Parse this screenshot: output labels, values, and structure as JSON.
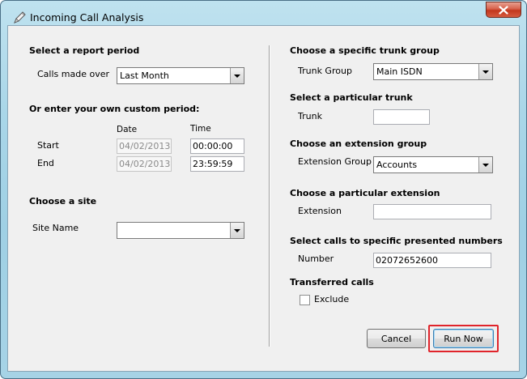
{
  "window": {
    "title": "Incoming Call Analysis"
  },
  "left": {
    "report_period_header": "Select a report period",
    "calls_made_over_label": "Calls made over",
    "calls_made_over_value": "Last Month",
    "custom_period_header": "Or enter your own custom period:",
    "date_col_label": "Date",
    "time_col_label": "Time",
    "start_label": "Start",
    "start_date": "04/02/2013",
    "start_time": "00:00:00",
    "end_label": "End",
    "end_date": "04/02/2013",
    "end_time": "23:59:59",
    "site_header": "Choose a site",
    "site_name_label": "Site Name",
    "site_name_value": ""
  },
  "right": {
    "trunk_group_header": "Choose a specific trunk group",
    "trunk_group_label": "Trunk Group",
    "trunk_group_value": "Main ISDN",
    "trunk_header": "Select a particular trunk",
    "trunk_label": "Trunk",
    "trunk_value": "",
    "ext_group_header": "Choose an extension group",
    "ext_group_label": "Extension Group",
    "ext_group_value": "Accounts",
    "extension_header": "Choose a particular extension",
    "extension_label": "Extension",
    "extension_value": "",
    "presented_header": "Select calls to specific presented numbers",
    "number_label": "Number",
    "number_value": "02072652600",
    "transferred_header": "Transferred calls",
    "exclude_label": "Exclude",
    "exclude_checked": false
  },
  "buttons": {
    "cancel": "Cancel",
    "run_now": "Run Now"
  },
  "colors": {
    "highlight": "#e0242b",
    "titlebar": "#a9d6e8",
    "close": "#c2361c"
  },
  "icons": {
    "app": "pen-icon",
    "close": "close-icon"
  }
}
